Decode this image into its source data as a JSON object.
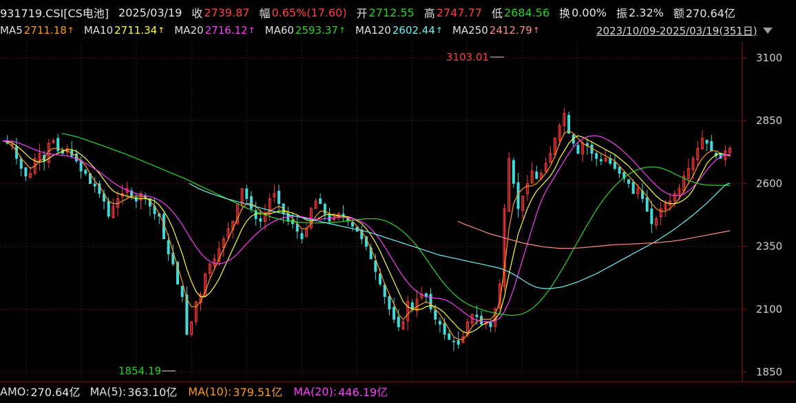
{
  "header": {
    "code": "931719.CSI[CS电池]",
    "date": "2025/03/19",
    "close_label": "收",
    "close": "2739.87",
    "change_label": "幅",
    "change": "0.65%(17.60)",
    "open_label": "开",
    "open": "2712.55",
    "high_label": "高",
    "high": "2747.77",
    "low_label": "低",
    "low": "2684.56",
    "turnover_label": "换",
    "turnover": "0.00%",
    "amplitude_label": "振",
    "amplitude": "2.32%",
    "amount_label": "额",
    "amount": "270.64亿"
  },
  "ma_legend": [
    {
      "label": "MA5",
      "value": "2711.18",
      "color": "#ff9b1a"
    },
    {
      "label": "MA10",
      "value": "2711.34",
      "color": "#ffff3c"
    },
    {
      "label": "MA20",
      "value": "2716.12",
      "color": "#ff3cff"
    },
    {
      "label": "MA60",
      "value": "2593.37",
      "color": "#2fd62f"
    },
    {
      "label": "MA120",
      "value": "2602.44",
      "color": "#6ef2f2"
    },
    {
      "label": "MA250",
      "value": "2412.79",
      "color": "#ff8c8c"
    }
  ],
  "range": {
    "text": "2023/10/09-2025/03/19(351日)"
  },
  "amo": {
    "label": "AMO:",
    "value": "270.64亿",
    "ma5_label": "MA(5):",
    "ma5_value": "363.10亿",
    "ma10_label": "MA(10):",
    "ma10_value": "379.51亿",
    "ma20_label": "MA(20):",
    "ma20_value": "446.19亿"
  },
  "chart_data": {
    "type": "line",
    "y_ticks": [
      "3100",
      "2850",
      "2600",
      "2350",
      "2100",
      "1850"
    ],
    "ylim": [
      1820,
      3180
    ],
    "max_annotation": "3103.01",
    "min_annotation": "1854.19",
    "colors": {
      "up": "#ff3b3b",
      "down": "#45d9d9",
      "grid": "#8b1a1a"
    },
    "close_path": [
      2770,
      2760,
      2755,
      2700,
      2660,
      2630,
      2640,
      2700,
      2720,
      2690,
      2760,
      2770,
      2730,
      2720,
      2740,
      2710,
      2690,
      2650,
      2640,
      2600,
      2590,
      2560,
      2530,
      2470,
      2510,
      2540,
      2560,
      2580,
      2550,
      2530,
      2560,
      2540,
      2510,
      2480,
      2470,
      2380,
      2320,
      2280,
      2200,
      2150,
      2000,
      2050,
      2130,
      2160,
      2240,
      2280,
      2300,
      2340,
      2380,
      2420,
      2450,
      2520,
      2580,
      2540,
      2500,
      2460,
      2450,
      2480,
      2540,
      2560,
      2520,
      2480,
      2450,
      2440,
      2410,
      2380,
      2420,
      2500,
      2530,
      2520,
      2480,
      2450,
      2460,
      2480,
      2470,
      2450,
      2430,
      2410,
      2380,
      2350,
      2300,
      2250,
      2200,
      2150,
      2100,
      2060,
      2030,
      2050,
      2130,
      2100,
      2140,
      2160,
      2150,
      2100,
      2060,
      2040,
      2000,
      1980,
      1970,
      1960,
      1990,
      2050,
      2080,
      2070,
      2040,
      2050,
      2030,
      2100,
      2200,
      2500,
      2700,
      2600,
      2500,
      2550,
      2600,
      2650,
      2620,
      2640,
      2680,
      2720,
      2780,
      2830,
      2880,
      2800,
      2760,
      2720,
      2760,
      2750,
      2720,
      2700,
      2690,
      2700,
      2680,
      2660,
      2640,
      2620,
      2600,
      2560,
      2580,
      2540,
      2490,
      2440,
      2460,
      2500,
      2520,
      2530,
      2560,
      2580,
      2630,
      2660,
      2700,
      2740,
      2780,
      2760,
      2730,
      2710,
      2700,
      2730,
      2740
    ],
    "ma5": [
      2770,
      2765,
      2750,
      2730,
      2700,
      2680,
      2660,
      2670,
      2690,
      2700,
      2730,
      2740,
      2740,
      2735,
      2730,
      2720,
      2710,
      2690,
      2670,
      2640,
      2610,
      2590,
      2560,
      2530,
      2520,
      2520,
      2530,
      2540,
      2550,
      2550,
      2550,
      2545,
      2530,
      2510,
      2480,
      2440,
      2390,
      2330,
      2270,
      2210,
      2140,
      2110,
      2110,
      2130,
      2170,
      2220,
      2260,
      2300,
      2340,
      2380,
      2420,
      2460,
      2500,
      2520,
      2520,
      2510,
      2490,
      2480,
      2490,
      2500,
      2510,
      2500,
      2480,
      2460,
      2440,
      2420,
      2420,
      2440,
      2470,
      2490,
      2490,
      2480,
      2470,
      2470,
      2470,
      2460,
      2450,
      2430,
      2410,
      2380,
      2340,
      2300,
      2250,
      2200,
      2160,
      2120,
      2080,
      2060,
      2080,
      2100,
      2110,
      2120,
      2130,
      2120,
      2100,
      2080,
      2050,
      2020,
      1990,
      1980,
      1980,
      2000,
      2030,
      2050,
      2060,
      2060,
      2060,
      2080,
      2130,
      2260,
      2420,
      2520,
      2560,
      2580,
      2590,
      2590,
      2600,
      2620,
      2640,
      2670,
      2710,
      2760,
      2800,
      2810,
      2800,
      2780,
      2760,
      2750,
      2740,
      2730,
      2720,
      2710,
      2700,
      2690,
      2670,
      2650,
      2630,
      2610,
      2590,
      2570,
      2550,
      2520,
      2500,
      2490,
      2490,
      2500,
      2520,
      2540,
      2570,
      2600,
      2630,
      2670,
      2700,
      2720,
      2730,
      2730,
      2720,
      2715,
      2711
    ],
    "ma10": [
      2770,
      2768,
      2762,
      2750,
      2735,
      2718,
      2700,
      2690,
      2685,
      2688,
      2700,
      2712,
      2720,
      2728,
      2735,
      2735,
      2728,
      2715,
      2700,
      2680,
      2660,
      2640,
      2615,
      2590,
      2570,
      2560,
      2555,
      2550,
      2545,
      2540,
      2540,
      2540,
      2538,
      2530,
      2515,
      2490,
      2460,
      2420,
      2370,
      2320,
      2260,
      2210,
      2170,
      2150,
      2150,
      2165,
      2190,
      2220,
      2260,
      2300,
      2340,
      2380,
      2420,
      2450,
      2470,
      2480,
      2480,
      2478,
      2480,
      2485,
      2490,
      2490,
      2488,
      2482,
      2475,
      2465,
      2455,
      2450,
      2455,
      2465,
      2475,
      2478,
      2476,
      2472,
      2470,
      2468,
      2462,
      2452,
      2440,
      2420,
      2395,
      2365,
      2330,
      2290,
      2250,
      2210,
      2170,
      2130,
      2110,
      2100,
      2098,
      2100,
      2110,
      2115,
      2110,
      2100,
      2085,
      2065,
      2045,
      2025,
      2010,
      2005,
      2010,
      2020,
      2035,
      2045,
      2050,
      2060,
      2085,
      2150,
      2240,
      2320,
      2400,
      2450,
      2500,
      2540,
      2570,
      2590,
      2610,
      2630,
      2660,
      2700,
      2730,
      2760,
      2780,
      2790,
      2785,
      2775,
      2765,
      2755,
      2745,
      2735,
      2725,
      2715,
      2700,
      2685,
      2670,
      2650,
      2630,
      2610,
      2590,
      2570,
      2550,
      2535,
      2525,
      2520,
      2520,
      2525,
      2535,
      2550,
      2575,
      2610,
      2645,
      2680,
      2700,
      2715,
      2720,
      2715,
      2711
    ],
    "ma20": [
      2770,
      2770,
      2768,
      2764,
      2758,
      2750,
      2742,
      2735,
      2728,
      2722,
      2718,
      2716,
      2714,
      2712,
      2710,
      2705,
      2698,
      2690,
      2680,
      2670,
      2658,
      2646,
      2632,
      2618,
      2604,
      2592,
      2582,
      2574,
      2566,
      2560,
      2556,
      2552,
      2548,
      2542,
      2534,
      2522,
      2506,
      2486,
      2462,
      2436,
      2406,
      2376,
      2348,
      2324,
      2304,
      2290,
      2282,
      2280,
      2284,
      2292,
      2304,
      2320,
      2340,
      2360,
      2380,
      2398,
      2414,
      2428,
      2440,
      2450,
      2458,
      2464,
      2468,
      2470,
      2470,
      2468,
      2464,
      2460,
      2458,
      2458,
      2460,
      2462,
      2464,
      2465,
      2465,
      2464,
      2461,
      2456,
      2448,
      2436,
      2420,
      2400,
      2376,
      2348,
      2318,
      2288,
      2258,
      2230,
      2206,
      2186,
      2170,
      2158,
      2150,
      2146,
      2144,
      2142,
      2138,
      2130,
      2118,
      2104,
      2090,
      2076,
      2064,
      2056,
      2052,
      2050,
      2050,
      2054,
      2064,
      2090,
      2130,
      2180,
      2240,
      2300,
      2360,
      2420,
      2480,
      2530,
      2570,
      2600,
      2630,
      2660,
      2690,
      2720,
      2745,
      2765,
      2778,
      2786,
      2790,
      2790,
      2786,
      2778,
      2768,
      2756,
      2742,
      2726,
      2708,
      2690,
      2670,
      2650,
      2630,
      2610,
      2592,
      2576,
      2564,
      2556,
      2552,
      2552,
      2558,
      2570,
      2586,
      2606,
      2630,
      2654,
      2676,
      2694,
      2706,
      2714,
      2716
    ],
    "ma60": [
      2800,
      2796,
      2792,
      2788,
      2783,
      2778,
      2772,
      2766,
      2760,
      2754,
      2748,
      2742,
      2736,
      2730,
      2724,
      2718,
      2711,
      2704,
      2697,
      2690,
      2683,
      2676,
      2669,
      2662,
      2655,
      2648,
      2641,
      2634,
      2627,
      2620,
      2612,
      2604,
      2596,
      2588,
      2580,
      2572,
      2564,
      2556,
      2548,
      2540,
      2532,
      2524,
      2516,
      2508,
      2500,
      2494,
      2488,
      2482,
      2476,
      2470,
      2464,
      2460,
      2456,
      2452,
      2450,
      2448,
      2446,
      2445,
      2444,
      2443,
      2443,
      2443,
      2443,
      2444,
      2445,
      2446,
      2448,
      2450,
      2452,
      2454,
      2456,
      2458,
      2460,
      2460,
      2460,
      2458,
      2454,
      2448,
      2440,
      2430,
      2418,
      2404,
      2388,
      2370,
      2350,
      2328,
      2304,
      2280,
      2256,
      2232,
      2210,
      2190,
      2172,
      2156,
      2142,
      2130,
      2120,
      2112,
      2106,
      2100,
      2094,
      2090,
      2086,
      2082,
      2080,
      2078,
      2076,
      2076,
      2078,
      2082,
      2090,
      2100,
      2114,
      2130,
      2150,
      2172,
      2196,
      2222,
      2250,
      2278,
      2308,
      2338,
      2368,
      2398,
      2428,
      2456,
      2484,
      2510,
      2534,
      2556,
      2576,
      2594,
      2610,
      2624,
      2636,
      2646,
      2654,
      2660,
      2664,
      2666,
      2666,
      2664,
      2660,
      2654,
      2646,
      2638,
      2630,
      2622,
      2614,
      2608,
      2602,
      2598,
      2595,
      2594,
      2593,
      2593,
      2593,
      2593,
      2593
    ],
    "ma120": [
      null,
      null,
      null,
      null,
      null,
      null,
      null,
      null,
      null,
      null,
      null,
      null,
      null,
      null,
      null,
      null,
      null,
      null,
      null,
      null,
      null,
      null,
      null,
      null,
      null,
      null,
      null,
      null,
      null,
      null,
      null,
      null,
      null,
      null,
      null,
      null,
      null,
      null,
      null,
      null,
      null,
      null,
      null,
      null,
      null,
      null,
      null,
      null,
      null,
      null,
      null,
      null,
      null,
      null,
      null,
      null,
      null,
      null,
      null,
      null,
      null,
      null,
      null,
      null,
      null,
      null,
      null,
      null,
      null,
      null,
      null,
      null,
      null,
      null,
      null,
      null,
      null,
      null,
      null,
      null,
      null,
      null,
      null,
      null,
      null,
      null,
      null,
      null,
      null,
      null,
      null,
      null,
      null,
      null,
      null,
      null,
      null,
      null,
      null,
      null,
      null,
      null,
      null,
      null,
      null,
      null,
      null,
      null,
      null,
      null,
      null,
      null,
      null,
      null,
      null,
      null,
      null,
      null,
      null,
      null,
      null,
      null,
      null,
      null,
      null,
      null,
      null,
      null,
      null,
      null,
      null,
      null,
      null,
      null,
      null,
      null,
      null,
      null,
      null,
      null,
      null,
      null,
      null,
      null,
      null,
      null,
      null,
      null,
      null,
      null,
      null,
      null,
      null,
      null,
      null,
      null,
      null,
      null,
      null,
      null,
      null
    ],
    "ma120_path": [
      2600,
      2590,
      2580,
      2572,
      2565,
      2558,
      2552,
      2546,
      2540,
      2535,
      2530,
      2525,
      2520,
      2515,
      2510,
      2505,
      2500,
      2495,
      2490,
      2486,
      2482,
      2478,
      2474,
      2470,
      2466,
      2462,
      2458,
      2454,
      2450,
      2446,
      2442,
      2438,
      2434,
      2430,
      2426,
      2422,
      2418,
      2414,
      2410,
      2406,
      2400,
      2394,
      2388,
      2382,
      2376,
      2370,
      2364,
      2358,
      2352,
      2346,
      2340,
      2334,
      2328,
      2322,
      2316,
      2312,
      2308,
      2304,
      2300,
      2296,
      2292,
      2288,
      2284,
      2280,
      2276,
      2272,
      2268,
      2264,
      2258,
      2250,
      2240,
      2230,
      2218,
      2206,
      2196,
      2188,
      2184,
      2182,
      2182,
      2184,
      2186,
      2190,
      2196,
      2202,
      2208,
      2216,
      2224,
      2232,
      2240,
      2250,
      2260,
      2270,
      2280,
      2290,
      2300,
      2310,
      2320,
      2330,
      2340,
      2350,
      2360,
      2370,
      2382,
      2394,
      2406,
      2418,
      2432,
      2446,
      2460,
      2474,
      2490,
      2506,
      2522,
      2540,
      2558,
      2576,
      2594,
      2602
    ],
    "ma250_path": [
      2450,
      2440,
      2432,
      2424,
      2416,
      2408,
      2400,
      2394,
      2388,
      2382,
      2376,
      2370,
      2364,
      2360,
      2356,
      2352,
      2348,
      2346,
      2344,
      2342,
      2342,
      2342,
      2343,
      2344,
      2346,
      2348,
      2350,
      2352,
      2354,
      2356,
      2357,
      2358,
      2359,
      2360,
      2361,
      2362,
      2363,
      2364,
      2366,
      2368,
      2370,
      2373,
      2376,
      2380,
      2384,
      2388,
      2392,
      2396,
      2400,
      2404,
      2408,
      2412
    ]
  }
}
